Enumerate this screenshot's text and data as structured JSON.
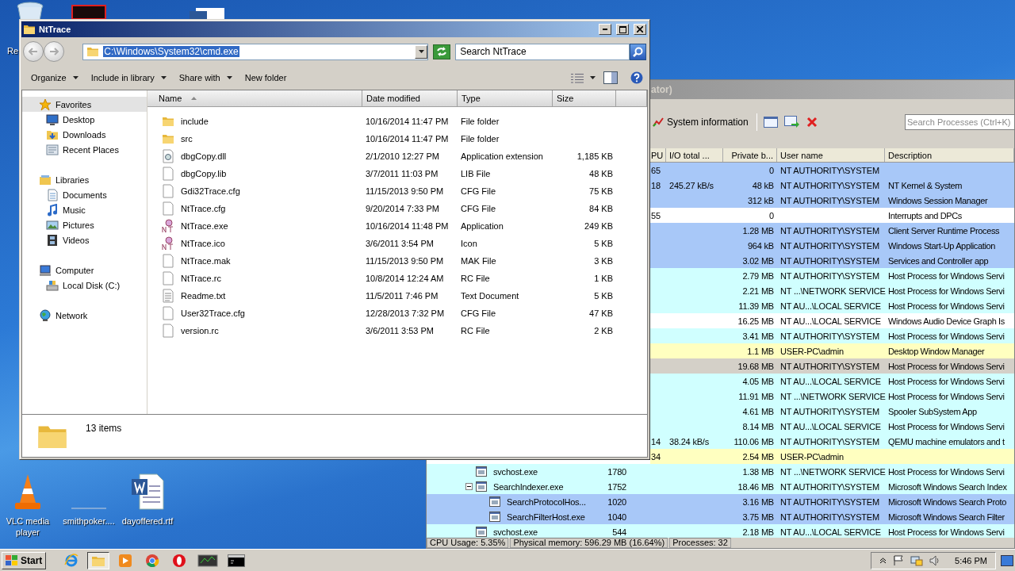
{
  "desktop": {
    "icons": [
      {
        "label": "Re",
        "kind": "recycle"
      },
      {
        "label": "VLC media player",
        "kind": "vlc"
      },
      {
        "label": "smithpoker....",
        "kind": "blank"
      },
      {
        "label": "dayoffered.rtf",
        "kind": "doc"
      }
    ]
  },
  "process_explorer": {
    "title": "ator)",
    "toolbar": {
      "button": "System information",
      "search": {
        "placeholder": "Search Processes (Ctrl+K)"
      }
    },
    "columns": [
      "PU",
      "I/O total ...",
      "Private b...",
      "User name",
      "Description"
    ],
    "rows": [
      {
        "cpu": "65",
        "private": "0",
        "user": "NT AUTHORITY\\SYSTEM",
        "color": "#a8c8f8"
      },
      {
        "cpu": "18",
        "io": "245.27 kB/s",
        "private": "48 kB",
        "user": "NT AUTHORITY\\SYSTEM",
        "description": "NT Kernel & System",
        "color": "#a8c8f8"
      },
      {
        "private": "312 kB",
        "user": "NT AUTHORITY\\SYSTEM",
        "description": "Windows Session Manager",
        "color": "#a8c8f8"
      },
      {
        "cpu": "55",
        "private": "0",
        "description": "Interrupts and DPCs",
        "color": "#ffffff"
      },
      {
        "private": "1.28 MB",
        "user": "NT AUTHORITY\\SYSTEM",
        "description": "Client Server Runtime Process",
        "color": "#a8c8f8"
      },
      {
        "private": "964 kB",
        "user": "NT AUTHORITY\\SYSTEM",
        "description": "Windows Start-Up Application",
        "color": "#a8c8f8"
      },
      {
        "private": "3.02 MB",
        "user": "NT AUTHORITY\\SYSTEM",
        "description": "Services and Controller app",
        "color": "#a8c8f8"
      },
      {
        "private": "2.79 MB",
        "user": "NT AUTHORITY\\SYSTEM",
        "description": "Host Process for Windows Servi",
        "color": "#d0ffff"
      },
      {
        "private": "2.21 MB",
        "user": "NT ...\\NETWORK SERVICE",
        "description": "Host Process for Windows Servi",
        "color": "#d0ffff"
      },
      {
        "private": "11.39 MB",
        "user": "NT AU...\\LOCAL SERVICE",
        "description": "Host Process for Windows Servi",
        "color": "#d0ffff"
      },
      {
        "private": "16.25 MB",
        "user": "NT AU...\\LOCAL SERVICE",
        "description": "Windows Audio Device Graph Is",
        "color": "#ffffff"
      },
      {
        "private": "3.41 MB",
        "user": "NT AUTHORITY\\SYSTEM",
        "description": "Host Process for Windows Servi",
        "color": "#d0ffff"
      },
      {
        "private": "1.1 MB",
        "user": "USER-PC\\admin",
        "description": "Desktop Window Manager",
        "color": "#ffffc0"
      },
      {
        "private": "19.68 MB",
        "user": "NT AUTHORITY\\SYSTEM",
        "description": "Host Process for Windows Servi",
        "color": "#d4d0c8"
      },
      {
        "private": "4.05 MB",
        "user": "NT AU...\\LOCAL SERVICE",
        "description": "Host Process for Windows Servi",
        "color": "#d0ffff"
      },
      {
        "private": "11.91 MB",
        "user": "NT ...\\NETWORK SERVICE",
        "description": "Host Process for Windows Servi",
        "color": "#d0ffff"
      },
      {
        "private": "4.61 MB",
        "user": "NT AUTHORITY\\SYSTEM",
        "description": "Spooler SubSystem App",
        "color": "#d0ffff"
      },
      {
        "private": "8.14 MB",
        "user": "NT AU...\\LOCAL SERVICE",
        "description": "Host Process for Windows Servi",
        "color": "#d0ffff"
      },
      {
        "cpu": "14",
        "io": "38.24 kB/s",
        "private": "110.06 MB",
        "user": "NT AUTHORITY\\SYSTEM",
        "description": "QEMU machine emulators and t",
        "color": "#d0ffff"
      },
      {
        "cpu": "34",
        "private": "2.54 MB",
        "user": "USER-PC\\admin",
        "color": "#ffffc0"
      },
      {
        "process": "svchost.exe",
        "pid": "1780",
        "private": "1.38 MB",
        "user": "NT ...\\NETWORK SERVICE",
        "description": "Host Process for Windows Servi",
        "color": "#d0ffff"
      },
      {
        "process": "SearchIndexer.exe",
        "pid": "1752",
        "private": "18.46 MB",
        "user": "NT AUTHORITY\\SYSTEM",
        "description": "Microsoft Windows Search Index",
        "color": "#d0ffff",
        "expanded": true,
        "children": [
          {
            "process": "SearchProtocolHos...",
            "pid": "1020",
            "private": "3.16 MB",
            "user": "NT AUTHORITY\\SYSTEM",
            "description": "Microsoft Windows Search Proto",
            "color": "#a8c8f8"
          },
          {
            "process": "SearchFilterHost.exe",
            "pid": "1040",
            "private": "3.75 MB",
            "user": "NT AUTHORITY\\SYSTEM",
            "description": "Microsoft Windows Search Filter",
            "color": "#a8c8f8"
          }
        ]
      },
      {
        "process": "svchost.exe",
        "pid": "544",
        "private": "2.18 MB",
        "user": "NT AU...\\LOCAL SERVICE",
        "description": "Host Process for Windows Servi",
        "color": "#d0ffff"
      }
    ],
    "status_bar": [
      "CPU Usage: 5.35%",
      "Physical memory: 596.29 MB (16.64%)",
      "Processes: 32"
    ]
  },
  "explorer": {
    "title": "NtTrace",
    "address": {
      "value": "C:\\Windows\\System32\\cmd.exe",
      "selected": true
    },
    "search": {
      "placeholder": "Search NtTrace"
    },
    "toolbar": [
      {
        "label": "Organize",
        "dropdown": true
      },
      {
        "label": "Include in library",
        "dropdown": true
      },
      {
        "label": "Share with",
        "dropdown": true
      },
      {
        "label": "New folder",
        "dropdown": false
      }
    ],
    "nav": [
      {
        "label": "Favorites",
        "kind": "star",
        "selected": true,
        "children": [
          {
            "label": "Desktop",
            "kind": "desktop",
            "selected": false
          },
          {
            "label": "Downloads",
            "kind": "downloads",
            "selected": false
          },
          {
            "label": "Recent Places",
            "kind": "recent",
            "selected": false
          }
        ]
      },
      {
        "label": "Libraries",
        "kind": "libraries",
        "selected": false,
        "children": [
          {
            "label": "Documents",
            "kind": "documents",
            "selected": false
          },
          {
            "label": "Music",
            "kind": "music",
            "selected": false
          },
          {
            "label": "Pictures",
            "kind": "pictures",
            "selected": false
          },
          {
            "label": "Videos",
            "kind": "videos",
            "selected": false
          }
        ]
      },
      {
        "label": "Computer",
        "kind": "computer",
        "selected": false,
        "children": [
          {
            "label": "Local Disk (C:)",
            "kind": "disk",
            "selected": false
          }
        ]
      },
      {
        "label": "Network",
        "kind": "network",
        "selected": false
      }
    ],
    "columns": [
      {
        "label": "Name",
        "sorted": true
      },
      {
        "label": "Date modified",
        "sorted": false
      },
      {
        "label": "Type",
        "sorted": false
      },
      {
        "label": "Size",
        "sorted": false
      }
    ],
    "files": [
      {
        "name": "include",
        "date": "10/16/2014 11:47 PM",
        "type": "File folder",
        "kind": "folder"
      },
      {
        "name": "src",
        "date": "10/16/2014 11:47 PM",
        "type": "File folder",
        "kind": "folder"
      },
      {
        "name": "dbgCopy.dll",
        "date": "2/1/2010 12:27 PM",
        "type": "Application extension",
        "size": "1,185 KB",
        "kind": "dll"
      },
      {
        "name": "dbgCopy.lib",
        "date": "3/7/2011 11:03 PM",
        "type": "LIB File",
        "size": "48 KB",
        "kind": "file"
      },
      {
        "name": "Gdi32Trace.cfg",
        "date": "11/15/2013 9:50 PM",
        "type": "CFG File",
        "size": "75 KB",
        "kind": "file"
      },
      {
        "name": "NtTrace.cfg",
        "date": "9/20/2014 7:33 PM",
        "type": "CFG File",
        "size": "84 KB",
        "kind": "file"
      },
      {
        "name": "NtTrace.exe",
        "date": "10/16/2014 11:48 PM",
        "type": "Application",
        "size": "249 KB",
        "kind": "app"
      },
      {
        "name": "NtTrace.ico",
        "date": "3/6/2011 3:54 PM",
        "type": "Icon",
        "size": "5 KB",
        "kind": "app"
      },
      {
        "name": "NtTrace.mak",
        "date": "11/15/2013 9:50 PM",
        "type": "MAK File",
        "size": "3 KB",
        "kind": "file"
      },
      {
        "name": "NtTrace.rc",
        "date": "10/8/2014 12:24 AM",
        "type": "RC File",
        "size": "1 KB",
        "kind": "file"
      },
      {
        "name": "Readme.txt",
        "date": "11/5/2011 7:46 PM",
        "type": "Text Document",
        "size": "5 KB",
        "kind": "text"
      },
      {
        "name": "User32Trace.cfg",
        "date": "12/28/2013 7:32 PM",
        "type": "CFG File",
        "size": "47 KB",
        "kind": "file"
      },
      {
        "name": "version.rc",
        "date": "3/6/2011 3:53 PM",
        "type": "RC File",
        "size": "2 KB",
        "kind": "file"
      }
    ],
    "status": "13 items"
  },
  "taskbar": {
    "start": "Start",
    "apps": [
      {
        "kind": "ie",
        "active": false
      },
      {
        "kind": "explorer",
        "active": true
      },
      {
        "kind": "media",
        "active": false
      },
      {
        "kind": "chrome",
        "active": false
      },
      {
        "kind": "opera",
        "active": false
      },
      {
        "kind": "procexp",
        "active": false
      },
      {
        "kind": "cmd",
        "active": false
      }
    ],
    "clock": "5:46 PM"
  }
}
